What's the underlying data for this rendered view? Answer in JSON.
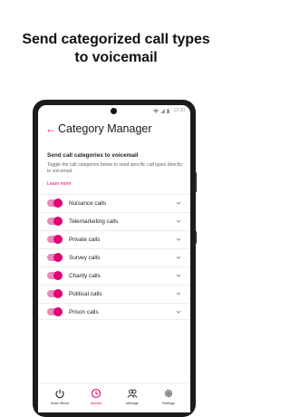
{
  "headline": {
    "line1": "Send categorized call types",
    "line2": "to voicemail"
  },
  "status_bar": {
    "time": "12:30"
  },
  "app_bar": {
    "back_icon": "arrow-left-icon",
    "title": "Category Manager"
  },
  "content": {
    "section_title": "Send call categories to voicemail",
    "description": "Toggle the call categories below to send specific call types directly to voicemail.",
    "learn_more": "Learn more"
  },
  "categories": [
    {
      "label": "Nuisance calls",
      "enabled": true
    },
    {
      "label": "Telemarketing calls",
      "enabled": true
    },
    {
      "label": "Private calls",
      "enabled": true
    },
    {
      "label": "Survey calls",
      "enabled": true
    },
    {
      "label": "Charity calls",
      "enabled": true
    },
    {
      "label": "Political calls",
      "enabled": true
    },
    {
      "label": "Prison calls",
      "enabled": true
    }
  ],
  "bottom_nav": [
    {
      "label": "Scam Block",
      "icon": "power-icon",
      "active": false
    },
    {
      "label": "Activity",
      "icon": "clock-icon",
      "active": true
    },
    {
      "label": "Manage",
      "icon": "people-icon",
      "active": false
    },
    {
      "label": "Settings",
      "icon": "gear-icon",
      "active": false
    }
  ],
  "colors": {
    "accent": "#e20074",
    "toggle_track": "#e98ab9",
    "text": "#222222"
  }
}
